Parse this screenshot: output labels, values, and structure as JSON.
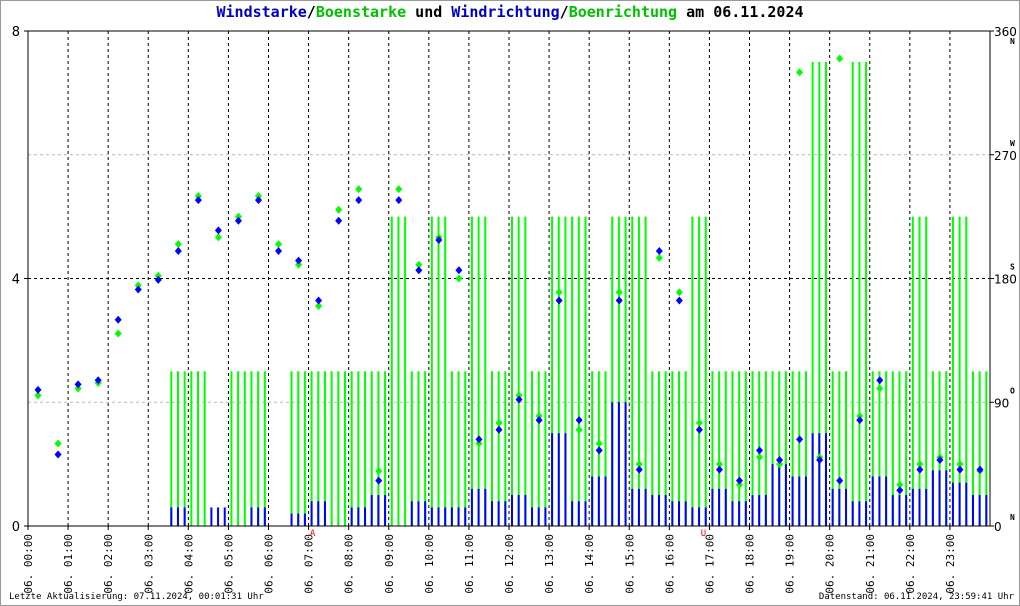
{
  "chart_data": {
    "type": "scatter",
    "title_parts": [
      {
        "text": "Windstarke",
        "color": "#0000c0"
      },
      {
        "text": "/",
        "color": "#000000"
      },
      {
        "text": "Boenstarke",
        "color": "#00c000"
      },
      {
        "text": " und ",
        "color": "#000000"
      },
      {
        "text": "Windrichtung",
        "color": "#0000c0"
      },
      {
        "text": "/",
        "color": "#000000"
      },
      {
        "text": "Boenrichtung",
        "color": "#00c000"
      },
      {
        "text": " am 06.11.2024",
        "color": "#000000"
      }
    ],
    "x_ticks": [
      "06. 00:00",
      "06. 01:00",
      "06. 02:00",
      "06. 03:00",
      "06. 04:00",
      "06. 05:00",
      "06. 06:00",
      "06. 07:00",
      "06. 08:00",
      "06. 09:00",
      "06. 10:00",
      "06. 11:00",
      "06. 12:00",
      "06. 13:00",
      "06. 14:00",
      "06. 15:00",
      "06. 16:00",
      "06. 17:00",
      "06. 18:00",
      "06. 19:00",
      "06. 20:00",
      "06. 21:00",
      "06. 22:00",
      "06. 23:00"
    ],
    "xlim_hours": [
      0,
      24
    ],
    "y_left": {
      "ticks": [
        "0",
        "4",
        "8"
      ],
      "ylim": [
        0,
        8
      ]
    },
    "y_right": {
      "ticks": [
        "0",
        "90",
        "180",
        "270",
        "360"
      ],
      "compass": [
        "N",
        "O",
        "S",
        "W",
        "N"
      ],
      "ylim": [
        0,
        360
      ]
    },
    "markers": [
      {
        "label": "A",
        "hour": 7.1,
        "color": "#ff0000"
      },
      {
        "label": "U",
        "hour": 16.85,
        "color": "#ff0000"
      }
    ],
    "sample_interval_hours": 0.5,
    "series": [
      {
        "name": "Windstarke",
        "kind": "bar",
        "axis": "left",
        "color": "#0000ff",
        "values": [
          0,
          0,
          0,
          0,
          0,
          0,
          0,
          0.3,
          0,
          0.3,
          0,
          0.3,
          0,
          0.2,
          0.4,
          0,
          0.3,
          0.5,
          0,
          0.4,
          0.3,
          0.3,
          0.6,
          0.4,
          0.5,
          0.3,
          1.5,
          0.4,
          0.8,
          2.0,
          0.6,
          0.5,
          0.4,
          0.3,
          0.6,
          0.4,
          0.5,
          1.0,
          0.8,
          1.5,
          0.6,
          0.4,
          0.8,
          0.5,
          0.6,
          0.9,
          0.7,
          0.5
        ]
      },
      {
        "name": "Boenstarke",
        "kind": "bar",
        "axis": "left",
        "color": "#00ff00",
        "values": [
          0,
          0,
          0,
          0,
          0,
          0,
          0,
          2.5,
          2.5,
          0,
          2.5,
          2.5,
          0,
          2.5,
          2.5,
          2.5,
          2.5,
          2.5,
          5,
          2.5,
          5,
          2.5,
          5,
          2.5,
          5,
          2.5,
          5,
          5,
          2.5,
          5,
          5,
          2.5,
          2.5,
          5,
          2.5,
          2.5,
          2.5,
          2.5,
          2.5,
          7.5,
          2.5,
          7.5,
          2.5,
          2.5,
          5,
          2.5,
          5,
          2.5
        ]
      },
      {
        "name": "Windrichtung",
        "kind": "points",
        "axis": "right",
        "color": "#0000ff",
        "values": [
          99,
          52,
          103,
          106,
          150,
          172,
          179,
          200,
          237,
          215,
          222,
          237,
          200,
          193,
          164,
          222,
          237,
          33,
          237,
          186,
          208,
          186,
          63,
          70,
          92,
          77,
          164,
          77,
          55,
          164,
          41,
          200,
          164,
          70,
          41,
          33,
          55,
          48,
          63,
          48,
          33,
          77,
          106,
          26,
          41,
          48,
          41,
          41
        ]
      },
      {
        "name": "Boenrichtung",
        "kind": "points",
        "axis": "right",
        "color": "#00ff00",
        "values": [
          95,
          60,
          100,
          104,
          140,
          175,
          182,
          205,
          240,
          210,
          225,
          240,
          205,
          190,
          160,
          230,
          245,
          40,
          245,
          190,
          210,
          180,
          60,
          75,
          95,
          80,
          170,
          70,
          60,
          170,
          45,
          195,
          170,
          75,
          45,
          30,
          50,
          45,
          330,
          50,
          340,
          80,
          100,
          30,
          45,
          50,
          45,
          40
        ]
      }
    ]
  },
  "footer": {
    "left": "Letzte Aktualisierung: 07.11.2024, 00:01:31 Uhr",
    "right": "Datenstand: 06.11.2024, 23:59:41 Uhr"
  }
}
